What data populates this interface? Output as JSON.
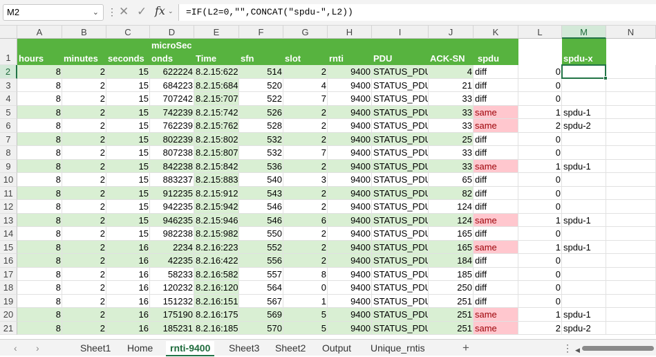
{
  "formula_bar": {
    "name_box": "M2",
    "fx_label": "fx",
    "formula": "=IF(L2=0,\"\",CONCAT(\"spdu-\",L2))"
  },
  "column_headers": [
    "A",
    "B",
    "C",
    "D",
    "E",
    "F",
    "G",
    "H",
    "I",
    "J",
    "K",
    "L",
    "M",
    "N"
  ],
  "header_row": {
    "row_number": "1",
    "cells": [
      "hours",
      "minutes",
      "seconds",
      "onds",
      "Time",
      "sfn",
      "slot",
      "rnti",
      "PDU",
      "ACK-SN",
      "spdu",
      "",
      "spdu-x",
      ""
    ],
    "d_top": "microSec"
  },
  "rows": [
    {
      "n": "2",
      "hours": "8",
      "minutes": "2",
      "seconds": "15",
      "micro": "622224",
      "time": "8.2.15:622",
      "sfn": "514",
      "slot": "2",
      "rnti": "9400",
      "pdu": "STATUS_PDU",
      "acksn": "4",
      "spdu": "diff",
      "l": "0",
      "m": "",
      "hl": true
    },
    {
      "n": "3",
      "hours": "8",
      "minutes": "2",
      "seconds": "15",
      "micro": "684223",
      "time": "8.2.15:684",
      "sfn": "520",
      "slot": "4",
      "rnti": "9400",
      "pdu": "STATUS_PDU",
      "acksn": "21",
      "spdu": "diff",
      "l": "0",
      "m": "",
      "hl": false
    },
    {
      "n": "4",
      "hours": "8",
      "minutes": "2",
      "seconds": "15",
      "micro": "707242",
      "time": "8.2.15:707",
      "sfn": "522",
      "slot": "7",
      "rnti": "9400",
      "pdu": "STATUS_PDU",
      "acksn": "33",
      "spdu": "diff",
      "l": "0",
      "m": "",
      "hl": false
    },
    {
      "n": "5",
      "hours": "8",
      "minutes": "2",
      "seconds": "15",
      "micro": "742239",
      "time": "8.2.15:742",
      "sfn": "526",
      "slot": "2",
      "rnti": "9400",
      "pdu": "STATUS_PDU",
      "acksn": "33",
      "spdu": "same",
      "l": "1",
      "m": "spdu-1",
      "hl": true
    },
    {
      "n": "6",
      "hours": "8",
      "minutes": "2",
      "seconds": "15",
      "micro": "762239",
      "time": "8.2.15:762",
      "sfn": "528",
      "slot": "2",
      "rnti": "9400",
      "pdu": "STATUS_PDU",
      "acksn": "33",
      "spdu": "same",
      "l": "2",
      "m": "spdu-2",
      "hl": false
    },
    {
      "n": "7",
      "hours": "8",
      "minutes": "2",
      "seconds": "15",
      "micro": "802239",
      "time": "8.2.15:802",
      "sfn": "532",
      "slot": "2",
      "rnti": "9400",
      "pdu": "STATUS_PDU",
      "acksn": "25",
      "spdu": "diff",
      "l": "0",
      "m": "",
      "hl": true
    },
    {
      "n": "8",
      "hours": "8",
      "minutes": "2",
      "seconds": "15",
      "micro": "807238",
      "time": "8.2.15:807",
      "sfn": "532",
      "slot": "7",
      "rnti": "9400",
      "pdu": "STATUS_PDU",
      "acksn": "33",
      "spdu": "diff",
      "l": "0",
      "m": "",
      "hl": false
    },
    {
      "n": "9",
      "hours": "8",
      "minutes": "2",
      "seconds": "15",
      "micro": "842238",
      "time": "8.2.15:842",
      "sfn": "536",
      "slot": "2",
      "rnti": "9400",
      "pdu": "STATUS_PDU",
      "acksn": "33",
      "spdu": "same",
      "l": "1",
      "m": "spdu-1",
      "hl": true
    },
    {
      "n": "10",
      "hours": "8",
      "minutes": "2",
      "seconds": "15",
      "micro": "883237",
      "time": "8.2.15:883",
      "sfn": "540",
      "slot": "3",
      "rnti": "9400",
      "pdu": "STATUS_PDU",
      "acksn": "65",
      "spdu": "diff",
      "l": "0",
      "m": "",
      "hl": false
    },
    {
      "n": "11",
      "hours": "8",
      "minutes": "2",
      "seconds": "15",
      "micro": "912235",
      "time": "8.2.15:912",
      "sfn": "543",
      "slot": "2",
      "rnti": "9400",
      "pdu": "STATUS_PDU",
      "acksn": "82",
      "spdu": "diff",
      "l": "0",
      "m": "",
      "hl": true
    },
    {
      "n": "12",
      "hours": "8",
      "minutes": "2",
      "seconds": "15",
      "micro": "942235",
      "time": "8.2.15:942",
      "sfn": "546",
      "slot": "2",
      "rnti": "9400",
      "pdu": "STATUS_PDU",
      "acksn": "124",
      "spdu": "diff",
      "l": "0",
      "m": "",
      "hl": false
    },
    {
      "n": "13",
      "hours": "8",
      "minutes": "2",
      "seconds": "15",
      "micro": "946235",
      "time": "8.2.15:946",
      "sfn": "546",
      "slot": "6",
      "rnti": "9400",
      "pdu": "STATUS_PDU",
      "acksn": "124",
      "spdu": "same",
      "l": "1",
      "m": "spdu-1",
      "hl": true
    },
    {
      "n": "14",
      "hours": "8",
      "minutes": "2",
      "seconds": "15",
      "micro": "982238",
      "time": "8.2.15:982",
      "sfn": "550",
      "slot": "2",
      "rnti": "9400",
      "pdu": "STATUS_PDU",
      "acksn": "165",
      "spdu": "diff",
      "l": "0",
      "m": "",
      "hl": false
    },
    {
      "n": "15",
      "hours": "8",
      "minutes": "2",
      "seconds": "16",
      "micro": "2234",
      "time": "8.2.16:223",
      "sfn": "552",
      "slot": "2",
      "rnti": "9400",
      "pdu": "STATUS_PDU",
      "acksn": "165",
      "spdu": "same",
      "l": "1",
      "m": "spdu-1",
      "hl": true
    },
    {
      "n": "16",
      "hours": "8",
      "minutes": "2",
      "seconds": "16",
      "micro": "42235",
      "time": "8.2.16:422",
      "sfn": "556",
      "slot": "2",
      "rnti": "9400",
      "pdu": "STATUS_PDU",
      "acksn": "184",
      "spdu": "diff",
      "l": "0",
      "m": "",
      "hl": true
    },
    {
      "n": "17",
      "hours": "8",
      "minutes": "2",
      "seconds": "16",
      "micro": "58233",
      "time": "8.2.16:582",
      "sfn": "557",
      "slot": "8",
      "rnti": "9400",
      "pdu": "STATUS_PDU",
      "acksn": "185",
      "spdu": "diff",
      "l": "0",
      "m": "",
      "hl": false
    },
    {
      "n": "18",
      "hours": "8",
      "minutes": "2",
      "seconds": "16",
      "micro": "120232",
      "time": "8.2.16:120",
      "sfn": "564",
      "slot": "0",
      "rnti": "9400",
      "pdu": "STATUS_PDU",
      "acksn": "250",
      "spdu": "diff",
      "l": "0",
      "m": "",
      "hl": false
    },
    {
      "n": "19",
      "hours": "8",
      "minutes": "2",
      "seconds": "16",
      "micro": "151232",
      "time": "8.2.16:151",
      "sfn": "567",
      "slot": "1",
      "rnti": "9400",
      "pdu": "STATUS_PDU",
      "acksn": "251",
      "spdu": "diff",
      "l": "0",
      "m": "",
      "hl": false
    },
    {
      "n": "20",
      "hours": "8",
      "minutes": "2",
      "seconds": "16",
      "micro": "175190",
      "time": "8.2.16:175",
      "sfn": "569",
      "slot": "5",
      "rnti": "9400",
      "pdu": "STATUS_PDU",
      "acksn": "251",
      "spdu": "same",
      "l": "1",
      "m": "spdu-1",
      "hl": true
    },
    {
      "n": "21",
      "hours": "8",
      "minutes": "2",
      "seconds": "16",
      "micro": "185231",
      "time": "8.2.16:185",
      "sfn": "570",
      "slot": "5",
      "rnti": "9400",
      "pdu": "STATUS_PDU",
      "acksn": "251",
      "spdu": "same",
      "l": "2",
      "m": "spdu-2",
      "hl": true
    }
  ],
  "sheet_tabs": [
    "Sheet1",
    "Home",
    "rnti-9400",
    "Sheet3",
    "Sheet2",
    "Output",
    "Unique_rntis"
  ],
  "active_tab": "rnti-9400",
  "tab_nav": {
    "prev": "‹",
    "next": "›",
    "add": "+",
    "more": "⋮"
  },
  "colors": {
    "accent": "#217346",
    "header_fill": "#57b33f",
    "row_fill": "#d9efd3",
    "same_fill": "#ffc7ce",
    "same_text": "#9c0006"
  }
}
